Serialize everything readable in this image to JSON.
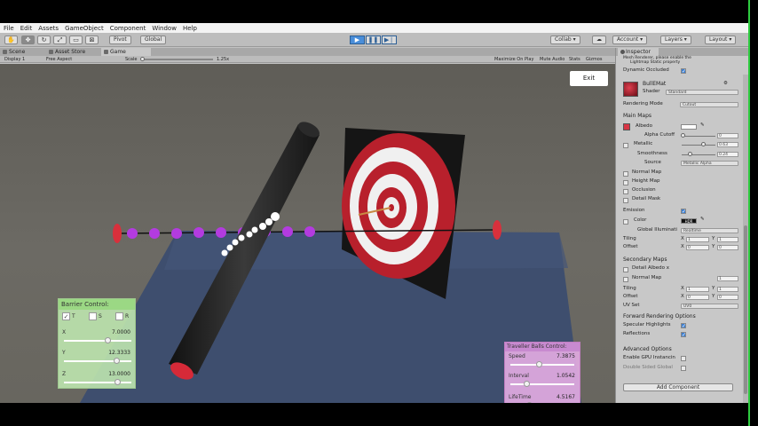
{
  "menu": [
    "File",
    "Edit",
    "Assets",
    "GameObject",
    "Component",
    "Window",
    "Help"
  ],
  "toolbar": {
    "pivot": "Pivot",
    "global": "Global",
    "collab": "Collab",
    "account": "Account",
    "layers": "Layers",
    "layout": "Layout"
  },
  "tabs": {
    "scene": "Scene",
    "asset_store": "Asset Store",
    "game": "Game"
  },
  "game_bar": {
    "display": "Display 1",
    "aspect": "Free Aspect",
    "scale_label": "Scale",
    "scale_value": "1.25x",
    "maximize": "Maximize On Play",
    "mute": "Mute Audio",
    "stats": "Stats",
    "gizmos": "Gizmos"
  },
  "exit_label": "Exit",
  "barrier": {
    "title": "Barrier Control:",
    "toggles": [
      {
        "label": "T",
        "checked": true
      },
      {
        "label": "S",
        "checked": false
      },
      {
        "label": "R",
        "checked": false
      }
    ],
    "fields": [
      {
        "label": "X",
        "value": "7.0000",
        "fraction": 0.65
      },
      {
        "label": "Y",
        "value": "12.3333",
        "fraction": 0.78
      },
      {
        "label": "Z",
        "value": "13.0000",
        "fraction": 0.8
      }
    ]
  },
  "traveller": {
    "title": "Traveller Balls Control:",
    "fields": [
      {
        "label": "Speed",
        "value": "7.3875",
        "fraction": 0.45
      },
      {
        "label": "Interval",
        "value": "1.0542",
        "fraction": 0.25
      },
      {
        "label": "LifeTime",
        "value": "4.5167",
        "fraction": 0.3
      }
    ]
  },
  "inspector": {
    "tab": "Inspector",
    "top_note_1": "Mesh Renderer, please enable the",
    "top_note_2": "Lightmap Static property",
    "dynamic_occluded": "Dynamic Occluded",
    "material_name": "BullEMat",
    "shader_label": "Shader",
    "shader_value": "Standard",
    "rendering_mode_label": "Rendering Mode",
    "rendering_mode_value": "Cutout",
    "main_maps": "Main Maps",
    "albedo": "Albedo",
    "alpha_cutoff": "Alpha Cutoff",
    "alpha_cutoff_value": "0",
    "metallic": "Metallic",
    "metallic_value": "0.63",
    "smoothness": "Smoothness",
    "smoothness_value": "0.24",
    "source_label": "Source",
    "source_value": "Metallic Alpha",
    "normal_map": "Normal Map",
    "height_map": "Height Map",
    "occlusion": "Occlusion",
    "detail_mask": "Detail Mask",
    "emission": "Emission",
    "color": "Color",
    "hdr": "HDR",
    "global_illum": "Global Illuminati",
    "global_illum_value": "Realtime",
    "tiling": "Tiling",
    "offset": "Offset",
    "tiling_x": "1",
    "tiling_y": "1",
    "offset_x": "0",
    "offset_y": "0",
    "secondary_maps": "Secondary Maps",
    "detail_albedo": "Detail Albedo x",
    "normal_map2": "Normal Map",
    "normal_map2_value": "1",
    "tiling2_x": "1",
    "tiling2_y": "1",
    "offset2_x": "0",
    "offset2_y": "0",
    "uv_set": "UV Set",
    "uv_set_value": "UV0",
    "forward_options": "Forward Rendering Options",
    "specular_highlights": "Specular Highlights",
    "reflections": "Reflections",
    "advanced_options": "Advanced Options",
    "enable_gpu": "Enable GPU Instancin",
    "double_sided": "Double Sided Global",
    "add_component": "Add Component"
  },
  "colors": {
    "play_blue": "#4a8ed9",
    "target_red": "#b8202c",
    "ball_purple": "#b33be0",
    "barrier_panel": "#bee6af",
    "traveller_panel": "#e1aae1"
  }
}
